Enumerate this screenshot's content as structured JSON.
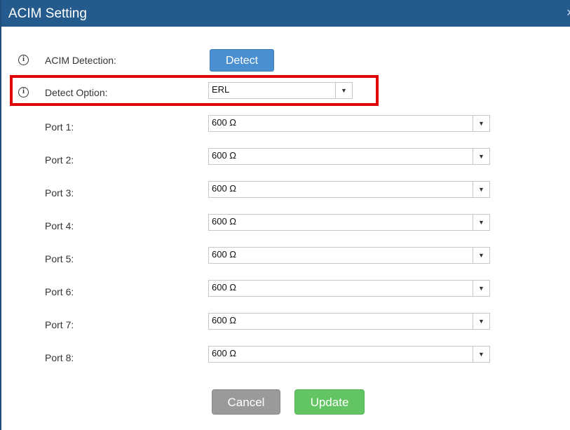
{
  "dialog": {
    "title": "ACIM Setting",
    "close_glyph": "×"
  },
  "acim_detection": {
    "label": "ACIM Detection:",
    "button_label": "Detect"
  },
  "detect_option": {
    "label": "Detect Option:",
    "value": "ERL"
  },
  "ports": [
    {
      "label": "Port 1:",
      "value": "600 Ω"
    },
    {
      "label": "Port 2:",
      "value": "600 Ω"
    },
    {
      "label": "Port 3:",
      "value": "600 Ω"
    },
    {
      "label": "Port 4:",
      "value": "600 Ω"
    },
    {
      "label": "Port 5:",
      "value": "600 Ω"
    },
    {
      "label": "Port 6:",
      "value": "600 Ω"
    },
    {
      "label": "Port 7:",
      "value": "600 Ω"
    },
    {
      "label": "Port 8:",
      "value": "600 Ω"
    }
  ],
  "actions": {
    "cancel_label": "Cancel",
    "update_label": "Update"
  },
  "colors": {
    "titlebar": "#245b8c",
    "detect_button": "#4a8fcf",
    "cancel_button": "#9a9a9a",
    "update_button": "#62c462",
    "highlight": "#e00000"
  }
}
